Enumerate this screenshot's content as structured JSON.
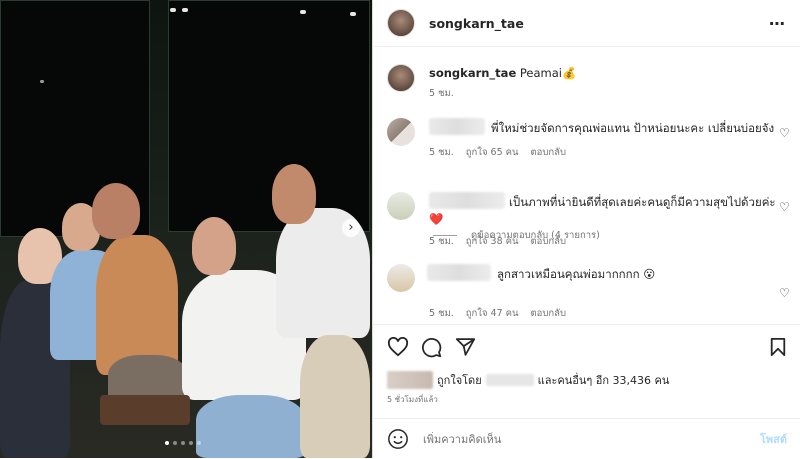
{
  "post": {
    "username": "songkarn_tae",
    "caption_user": "songkarn_tae",
    "caption_text": "Peamai💰",
    "caption_time": "5 ชม.",
    "more_icon": "⋯"
  },
  "photo": {
    "carousel_count": 5,
    "carousel_active": 1,
    "next_icon": "›"
  },
  "comments": [
    {
      "text": "พี่ใหม่ช่วยจัดการคุณพ่อแทน ป้าหน่อยนะคะ เปลี่ยนบ่อยจัง",
      "time": "5 ชม.",
      "likes": "ถูกใจ 65 คน",
      "reply": "ตอบกลับ"
    },
    {
      "text": "เป็นภาพที่น่ายินดีที่สุดเลยค่ะคนดูก็มีความสุขไปด้วยค่ะ",
      "emoji": "❤️",
      "time": "5 ชม.",
      "likes": "ถูกใจ 38 คน",
      "reply": "ตอบกลับ"
    },
    {
      "text": "ลูกสาวเหมือนคุณพ่อมากกกก 😮",
      "time": "5 ชม.",
      "likes": "ถูกใจ 47 คน",
      "reply": "ตอบกลับ"
    }
  ],
  "view_replies": "ดูข้อความตอบกลับ (4 รายการ)",
  "likes_line": {
    "prefix": "ถูกใจโดย",
    "suffix": "และคนอื่นๆ อีก 33,436 คน"
  },
  "time_ago": "5 ชั่วโมงที่แล้ว",
  "composer": {
    "placeholder": "เพิ่มความคิดเห็น",
    "post_label": "โพสต์"
  },
  "colors": {
    "accent_disabled": "#b3dbff",
    "heart_red": "#ed4956"
  }
}
